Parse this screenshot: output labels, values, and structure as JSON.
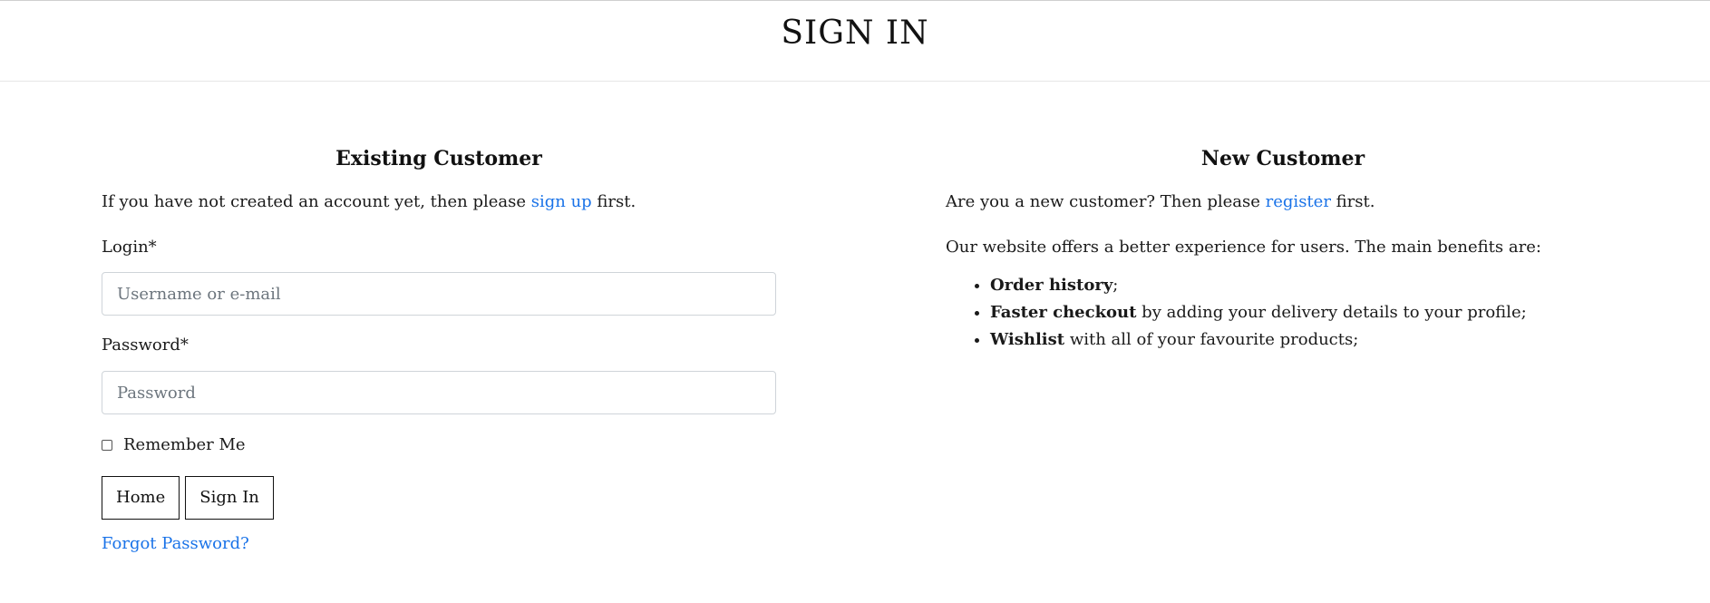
{
  "header": {
    "title": "SIGN IN"
  },
  "existing_customer": {
    "heading": "Existing Customer",
    "intro_before": "If you have not created an account yet, then please ",
    "intro_link": "sign up",
    "intro_after": " first.",
    "login_label": "Login*",
    "login_placeholder": "Username or e-mail",
    "password_label": "Password*",
    "password_placeholder": "Password",
    "remember_label": "Remember Me",
    "home_button": "Home",
    "signin_button": "Sign In",
    "forgot_link": "Forgot Password?"
  },
  "new_customer": {
    "heading": "New Customer",
    "intro_before": "Are you a new customer? Then please ",
    "intro_link": "register",
    "intro_after": " first.",
    "benefits_intro": "Our website offers a better experience for users. The main benefits are:",
    "benefits": [
      {
        "bold": "Order history",
        "rest": ";"
      },
      {
        "bold": "Faster checkout",
        "rest": " by adding your delivery details to your profile;"
      },
      {
        "bold": "Wishlist",
        "rest": " with all of your favourite products;"
      }
    ]
  },
  "colors": {
    "link": "#1a73e8",
    "text": "#1a1a1a",
    "input_border": "#cfd4d9"
  }
}
